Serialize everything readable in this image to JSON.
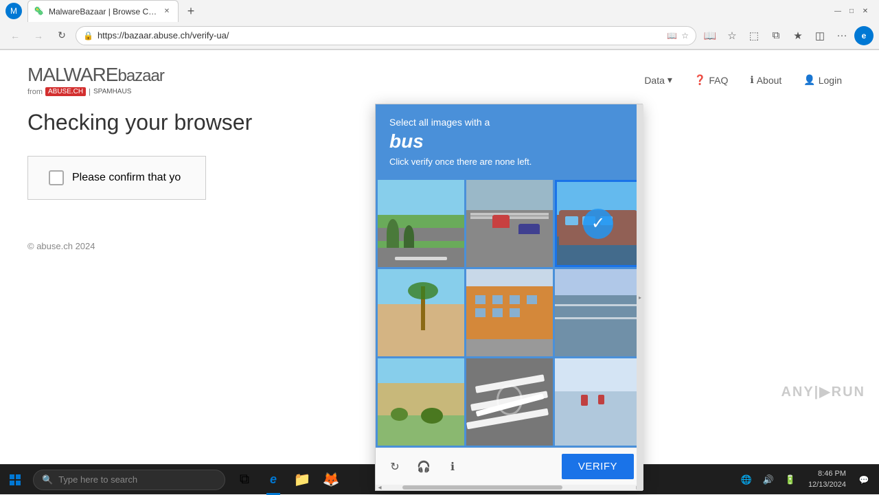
{
  "browser": {
    "title_bar": {
      "profile_initial": "M"
    },
    "tab": {
      "label": "MalwareBazaar | Browse Checkin...",
      "favicon": "🦠"
    },
    "new_tab_btn": "+",
    "address_bar": {
      "url": "https://bazaar.abuse.ch/verify-ua/"
    },
    "toolbar_icons": {
      "read": "📖",
      "favorites": "☆",
      "extensions": "⬚",
      "split": "⧉",
      "favorites_bar": "★",
      "collections": "◫",
      "more": "···",
      "edge_icon": "e"
    },
    "nav": {
      "back": "←",
      "forward": "→",
      "refresh": "↻",
      "minimize": "—",
      "maximize": "□",
      "close": "✕"
    }
  },
  "site": {
    "logo": {
      "brand": "MALWARE",
      "suffix": "bazaar",
      "sub_from": "from",
      "sub_abuse": "ABUSE.CH",
      "sub_pipe": "|",
      "sub_spamhaus": "SPAMHAUS"
    },
    "nav": [
      {
        "label": "Data",
        "has_dropdown": true
      },
      {
        "label": "FAQ"
      },
      {
        "label": "About"
      },
      {
        "label": "Login"
      }
    ]
  },
  "page": {
    "title": "Checking your browser",
    "verify_text": "Please confirm that yo",
    "footer": "© abuse.ch 2024"
  },
  "captcha": {
    "header": {
      "prompt": "Select all images with a",
      "word": "bus",
      "instruction": "Click verify once there are none left."
    },
    "grid": [
      {
        "id": 1,
        "scene": "scene-road-trees",
        "selected": false
      },
      {
        "id": 2,
        "scene": "scene-highway",
        "selected": false
      },
      {
        "id": 3,
        "scene": "scene-bus-selected",
        "selected": true
      },
      {
        "id": 4,
        "scene": "scene-wall-palm",
        "selected": false
      },
      {
        "id": 5,
        "scene": "scene-building",
        "selected": false
      },
      {
        "id": 6,
        "scene": "scene-road-blue",
        "selected": false
      },
      {
        "id": 7,
        "scene": "scene-desert",
        "selected": false
      },
      {
        "id": 8,
        "scene": "scene-road-markings",
        "selected": false
      },
      {
        "id": 9,
        "scene": "scene-moped",
        "selected": false
      }
    ],
    "footer": {
      "refresh_icon": "↻",
      "audio_icon": "🎧",
      "info_icon": "ℹ",
      "verify_btn": "VERIFY"
    }
  },
  "anyrun": {
    "text": "ANY",
    "sub": "RUN"
  },
  "taskbar": {
    "search_placeholder": "Type here to search",
    "apps": [
      {
        "name": "task-view",
        "icon": "⧉"
      },
      {
        "name": "edge-browser",
        "icon": "⬡",
        "active": true
      },
      {
        "name": "file-explorer",
        "icon": "📁"
      },
      {
        "name": "firefox",
        "icon": "🦊"
      }
    ],
    "time": "8:46 PM",
    "date": "12/13/2024"
  }
}
